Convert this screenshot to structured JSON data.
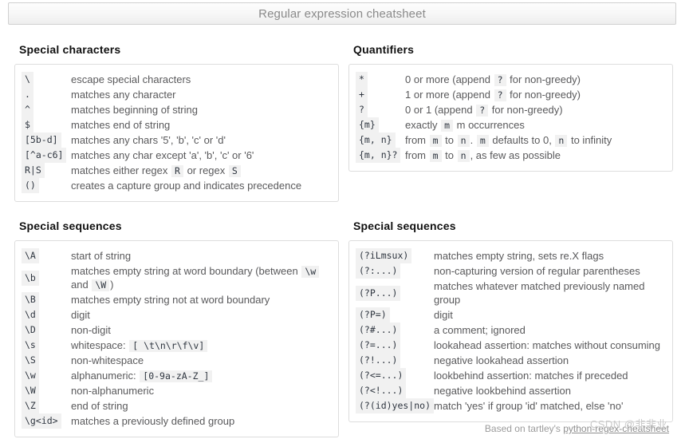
{
  "window": {
    "title": "Regular expression cheatsheet"
  },
  "sections": [
    {
      "id": "special-characters",
      "heading": "Special characters",
      "code_column": "narrow",
      "rows": [
        {
          "code": "\\",
          "desc": "escape special characters"
        },
        {
          "code": ".",
          "desc": "matches any character"
        },
        {
          "code": "^",
          "desc": "matches beginning of string"
        },
        {
          "code": "$",
          "desc": "matches end of string"
        },
        {
          "code": "[5b-d]",
          "desc": "matches any chars '5', 'b', 'c' or 'd'"
        },
        {
          "code": "[^a-c6]",
          "desc": "matches any char except 'a', 'b', 'c' or '6'"
        },
        {
          "code": "R|S",
          "desc_parts": [
            {
              "t": "text",
              "v": "matches either regex "
            },
            {
              "t": "code",
              "v": "R"
            },
            {
              "t": "text",
              "v": " or regex "
            },
            {
              "t": "code",
              "v": "S"
            }
          ]
        },
        {
          "code": "()",
          "desc": "creates a capture group and indicates precedence"
        }
      ]
    },
    {
      "id": "quantifiers",
      "heading": "Quantifiers",
      "code_column": "narrow",
      "rows": [
        {
          "code": "*",
          "desc_parts": [
            {
              "t": "text",
              "v": "0 or more (append "
            },
            {
              "t": "code",
              "v": "?"
            },
            {
              "t": "text",
              "v": " for non-greedy)"
            }
          ]
        },
        {
          "code": "+",
          "desc_parts": [
            {
              "t": "text",
              "v": "1 or more (append "
            },
            {
              "t": "code",
              "v": "?"
            },
            {
              "t": "text",
              "v": " for non-greedy)"
            }
          ]
        },
        {
          "code": "?",
          "desc_parts": [
            {
              "t": "text",
              "v": "0 or 1 (append "
            },
            {
              "t": "code",
              "v": "?"
            },
            {
              "t": "text",
              "v": " for non-greedy)"
            }
          ]
        },
        {
          "code": "{m}",
          "desc_parts": [
            {
              "t": "text",
              "v": "exactly "
            },
            {
              "t": "code",
              "v": "m"
            },
            {
              "t": "text",
              "v": " m occurrences"
            }
          ]
        },
        {
          "code": "{m, n}",
          "desc_parts": [
            {
              "t": "text",
              "v": "from "
            },
            {
              "t": "code",
              "v": "m"
            },
            {
              "t": "text",
              "v": " to "
            },
            {
              "t": "code",
              "v": "n"
            },
            {
              "t": "text",
              "v": ". "
            },
            {
              "t": "code",
              "v": "m"
            },
            {
              "t": "text",
              "v": " defaults to 0, "
            },
            {
              "t": "code",
              "v": "n"
            },
            {
              "t": "text",
              "v": " to infinity"
            }
          ]
        },
        {
          "code": "{m, n}?",
          "desc_parts": [
            {
              "t": "text",
              "v": "from "
            },
            {
              "t": "code",
              "v": "m"
            },
            {
              "t": "text",
              "v": " to "
            },
            {
              "t": "code",
              "v": "n"
            },
            {
              "t": "text",
              "v": ", as few as possible"
            }
          ]
        }
      ]
    },
    {
      "id": "special-sequences-left",
      "heading": "Special sequences",
      "code_column": "narrow",
      "rows": [
        {
          "code": "\\A",
          "desc": "start of string"
        },
        {
          "code": "\\b",
          "desc_parts": [
            {
              "t": "text",
              "v": "matches empty string at word boundary (between "
            },
            {
              "t": "code",
              "v": "\\w"
            },
            {
              "t": "text",
              "v": " and "
            },
            {
              "t": "code",
              "v": "\\W"
            },
            {
              "t": "text",
              "v": ")"
            }
          ]
        },
        {
          "code": "\\B",
          "desc": "matches empty string not at word boundary"
        },
        {
          "code": "\\d",
          "desc": "digit"
        },
        {
          "code": "\\D",
          "desc": "non-digit"
        },
        {
          "code": "\\s",
          "desc_parts": [
            {
              "t": "text",
              "v": "whitespace: "
            },
            {
              "t": "code",
              "v": "[ \\t\\n\\r\\f\\v]"
            }
          ]
        },
        {
          "code": "\\S",
          "desc": "non-whitespace"
        },
        {
          "code": "\\w",
          "desc_parts": [
            {
              "t": "text",
              "v": "alphanumeric: "
            },
            {
              "t": "code",
              "v": "[0-9a-zA-Z_]"
            }
          ]
        },
        {
          "code": "\\W",
          "desc": "non-alphanumeric"
        },
        {
          "code": "\\Z",
          "desc": "end of string"
        },
        {
          "code": "\\g<id>",
          "desc": "matches a previously defined group"
        }
      ]
    },
    {
      "id": "special-sequences-right",
      "heading": "Special sequences",
      "code_column": "wide",
      "rows": [
        {
          "code": "(?iLmsux)",
          "desc": "matches empty string, sets re.X flags"
        },
        {
          "code": "(?:...)",
          "desc": "non-capturing version of regular parentheses"
        },
        {
          "code": "(?P...)",
          "desc": "matches whatever matched previously named group"
        },
        {
          "code": "(?P=)",
          "desc": "digit"
        },
        {
          "code": "(?#...)",
          "desc": "a comment; ignored"
        },
        {
          "code": "(?=...)",
          "desc": "lookahead assertion: matches without consuming"
        },
        {
          "code": "(?!...)",
          "desc": "negative lookahead assertion"
        },
        {
          "code": "(?<=...)",
          "desc": "lookbehind assertion: matches if preceded"
        },
        {
          "code": "(?<!...)",
          "desc": "negative lookbehind assertion"
        },
        {
          "code": "(?(id)yes|no)",
          "desc": "match 'yes' if group 'id' matched, else 'no'"
        }
      ]
    }
  ],
  "footer": {
    "prefix": "Based on tartley's ",
    "link_label": "python-regex-cheatsheet"
  },
  "watermark": {
    "text": "CSDN @非非业"
  },
  "colors": {
    "page_background": "#ffffff",
    "panel_border": "#dddddd",
    "chip_background": "#f1f1f1",
    "description_text": "#59595b",
    "heading_text": "#111111",
    "title_text": "#8a8a8a"
  }
}
